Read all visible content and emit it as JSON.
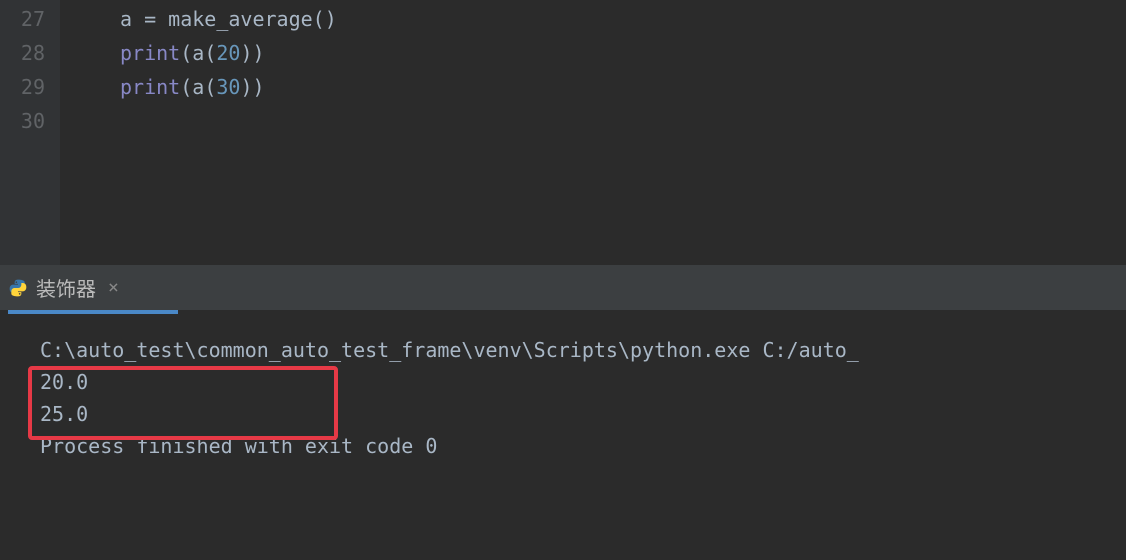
{
  "editor": {
    "lines": [
      {
        "number": "27"
      },
      {
        "number": "28"
      },
      {
        "number": "29"
      },
      {
        "number": "30"
      }
    ],
    "code": {
      "line27": {
        "var": "a",
        "eq": " = ",
        "func": "make_average",
        "parens": "()"
      },
      "line28": {
        "builtin": "print",
        "open": "(",
        "var": "a",
        "open2": "(",
        "num": "20",
        "close": "))"
      },
      "line29": {
        "builtin": "print",
        "open": "(",
        "var": "a",
        "open2": "(",
        "num": "30",
        "close": "))"
      }
    }
  },
  "terminal": {
    "tab_label": "装饰器",
    "tab_close": "×",
    "output": {
      "cmd": "C:\\auto_test\\common_auto_test_frame\\venv\\Scripts\\python.exe C:/auto_",
      "val1": "20.0",
      "val2": "25.0",
      "blank": "",
      "exit": "Process finished with exit code 0"
    }
  }
}
